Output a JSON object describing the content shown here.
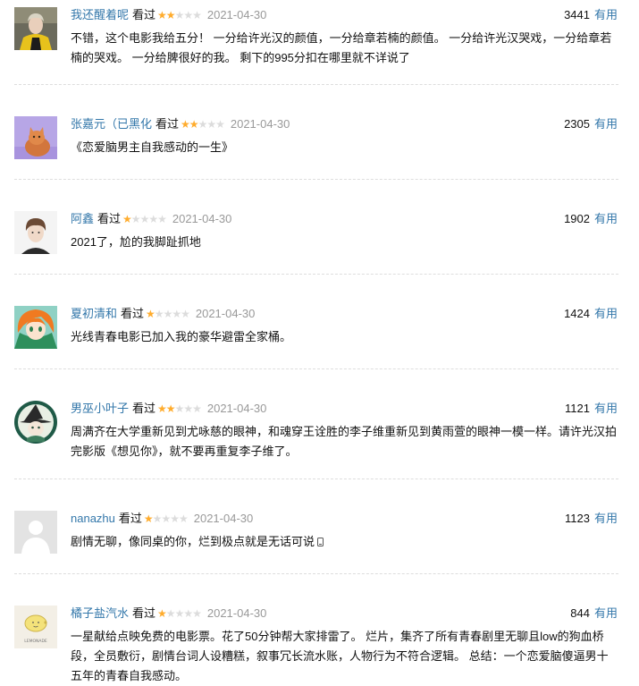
{
  "comments": [
    {
      "user": "我还醒着呢",
      "status": "看过",
      "rating": 2,
      "date": "2021-04-30",
      "votes": "3441",
      "useful_label": "有用",
      "text": "不错，这个电影我给五分！ 一分给许光汉的颜值，一分给章若楠的颜值。 一分给许光汉哭戏，一分给章若楠的哭戏。 一分给脾很好的我。 剩下的995分扣在哪里就不详说了",
      "avatar": "avatar-man-yellow-jacket"
    },
    {
      "user": "张嘉元（已黑化",
      "status": "看过",
      "rating": 2,
      "date": "2021-04-30",
      "votes": "2305",
      "useful_label": "有用",
      "text": "《恋爱脑男主自我感动的一生》",
      "avatar": "avatar-orange-cat-purple"
    },
    {
      "user": "阿鑫",
      "status": "看过",
      "rating": 1,
      "date": "2021-04-30",
      "votes": "1902",
      "useful_label": "有用",
      "text": "2021了，尬的我脚趾抓地",
      "avatar": "avatar-young-man"
    },
    {
      "user": "夏初清和",
      "status": "看过",
      "rating": 1,
      "date": "2021-04-30",
      "votes": "1424",
      "useful_label": "有用",
      "text": "光线青春电影已加入我的豪华避雷全家桶。",
      "avatar": "avatar-anime-girl-orange-hair"
    },
    {
      "user": "男巫小叶子",
      "status": "看过",
      "rating": 2,
      "date": "2021-04-30",
      "votes": "1121",
      "useful_label": "有用",
      "text": "周满齐在大学重新见到尤咏慈的眼神，和魂穿王诠胜的李子维重新见到黄雨萱的眼神一模一样。请许光汉拍完影版《想见你》，就不要再重复李子维了。",
      "avatar": "avatar-green-witch-badge"
    },
    {
      "user": "nanazhu",
      "status": "看过",
      "rating": 1,
      "date": "2021-04-30",
      "votes": "1123",
      "useful_label": "有用",
      "text": "剧情无聊，像同桌的你，烂到极点就是无话可说",
      "text_trailing_icon": "phone-icon",
      "avatar": "avatar-default-silhouette"
    },
    {
      "user": "橘子盐汽水",
      "status": "看过",
      "rating": 1,
      "date": "2021-04-30",
      "votes": "844",
      "useful_label": "有用",
      "text": "一星献给点映免费的电影票。花了50分钟帮大家排雷了。 烂片，集齐了所有青春剧里无聊且low的狗血桥段，全员敷衍，剧情台词人设糟糕，叙事冗长流水账，人物行为不符合逻辑。 总结：一个恋爱脑傻逼男十五年的青春自我感动。",
      "avatar": "avatar-lemon-drawing",
      "avatar_caption": "LEMONADE"
    }
  ],
  "colors": {
    "link": "#3377aa",
    "star_on": "#ffac2d",
    "star_off": "#dcdcdc",
    "date": "#999999",
    "divider": "#dddddd"
  }
}
